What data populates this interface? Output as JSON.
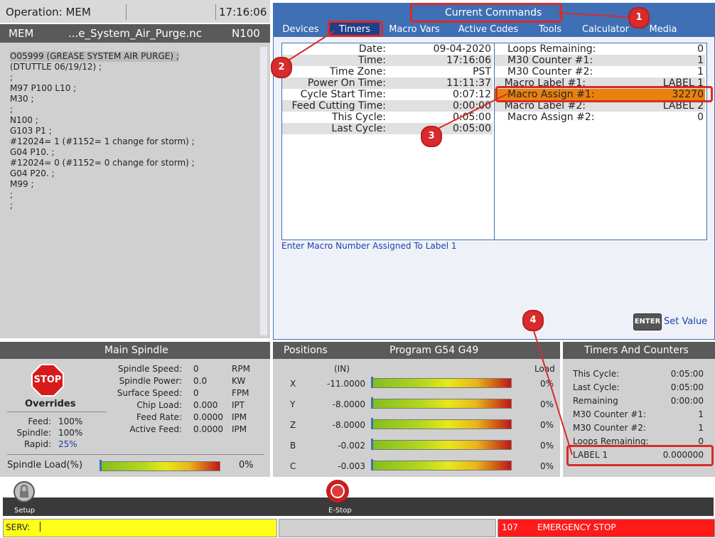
{
  "top_left": {
    "operation": "Operation: MEM",
    "time": "17:16:06"
  },
  "program_panel": {
    "mode": "MEM",
    "file": "...e_System_Air_Purge.nc",
    "line": "N100",
    "code_lines": [
      "O05999 (GREASE SYSTEM AIR PURGE) ;",
      "(DTUTTLE 06/19/12) ;",
      ";",
      "M97 P100 L10 ;",
      "M30 ;",
      ";",
      "N100 ;",
      "G103 P1 ;",
      "#12024= 1 (#1152= 1 change for storm) ;",
      "G04 P10. ;",
      "#12024= 0 (#1152= 0 change for storm) ;",
      "G04 P20. ;",
      "M99 ;",
      ";",
      ";"
    ]
  },
  "current_commands": {
    "title": "Current Commands",
    "tabs": [
      "Devices",
      "Timers",
      "Macro Vars",
      "Active Codes",
      "Tools",
      "Calculator",
      "Media"
    ],
    "left_rows": [
      {
        "label": "Date:",
        "value": "09-04-2020"
      },
      {
        "label": "Time:",
        "value": "17:16:06"
      },
      {
        "label": "Time Zone:",
        "value": "PST"
      },
      {
        "label": "Power On Time:",
        "value": "11:11:37"
      },
      {
        "label": "Cycle Start Time:",
        "value": "0:07:12"
      },
      {
        "label": "Feed Cutting Time:",
        "value": "0:00:00"
      },
      {
        "label": "This Cycle:",
        "value": "0:05:00"
      },
      {
        "label": "Last Cycle:",
        "value": "0:05:00"
      }
    ],
    "right_rows": [
      {
        "label": "Loops Remaining:",
        "value": "0"
      },
      {
        "label": "M30 Counter #1:",
        "value": "1"
      },
      {
        "label": "M30 Counter #2:",
        "value": "1"
      },
      {
        "label": "Macro Label #1:",
        "value": "LABEL 1"
      },
      {
        "label": "Macro Assign #1:",
        "value": "32270"
      },
      {
        "label": "Macro Label #2:",
        "value": "LABEL 2"
      },
      {
        "label": "Macro Assign #2:",
        "value": "0"
      }
    ],
    "hint": "Enter Macro Number Assigned To Label 1",
    "enter_key": "ENTER",
    "set_value": "Set Value"
  },
  "spindle": {
    "title": "Main Spindle",
    "stop": "STOP",
    "overrides_label": "Overrides",
    "overrides": [
      {
        "label": "Feed:",
        "value": "100%"
      },
      {
        "label": "Spindle:",
        "value": "100%"
      },
      {
        "label": "Rapid:",
        "value": "25%"
      }
    ],
    "stats": [
      {
        "label": "Spindle Speed:",
        "value": "0",
        "unit": "RPM"
      },
      {
        "label": "Spindle Power:",
        "value": "0.0",
        "unit": "KW"
      },
      {
        "label": "Surface Speed:",
        "value": "0",
        "unit": "FPM"
      },
      {
        "label": "Chip Load:",
        "value": "0.000",
        "unit": "IPT"
      },
      {
        "label": "Feed Rate:",
        "value": "0.0000",
        "unit": "IPM"
      },
      {
        "label": "Active Feed:",
        "value": "0.0000",
        "unit": "IPM"
      }
    ],
    "load_label": "Spindle Load(%)",
    "load_value": "0%",
    "load_fraction": 0
  },
  "positions": {
    "title": "Positions",
    "program": "Program G54 G49",
    "units": "(IN)",
    "load_label": "Load",
    "axes": [
      {
        "axis": "X",
        "value": "-11.0000",
        "load": "0%"
      },
      {
        "axis": "Y",
        "value": "-8.0000",
        "load": "0%"
      },
      {
        "axis": "Z",
        "value": "-8.0000",
        "load": "0%"
      },
      {
        "axis": "B",
        "value": "-0.002",
        "load": "0%"
      },
      {
        "axis": "C",
        "value": "-0.003",
        "load": "0%"
      }
    ]
  },
  "timers_counters": {
    "title": "Timers And Counters",
    "rows": [
      {
        "label": "This Cycle:",
        "value": "0:05:00"
      },
      {
        "label": "Last Cycle:",
        "value": "0:05:00"
      },
      {
        "label": "Remaining",
        "value": "0:00:00"
      },
      {
        "label": "M30 Counter #1:",
        "value": "1"
      },
      {
        "label": "M30 Counter #2:",
        "value": "1"
      },
      {
        "label": "Loops Remaining:",
        "value": "0"
      },
      {
        "label": "LABEL 1",
        "value": "0.000000"
      }
    ]
  },
  "bottom": {
    "setup": "Setup",
    "estop": "E-Stop",
    "serv": "SERV:",
    "alarm_code": "107",
    "alarm_text": "EMERGENCY STOP"
  },
  "callouts": [
    "1",
    "2",
    "3",
    "4"
  ],
  "colors": {
    "accent": "#3f6fb5",
    "highlight": "#e8820c",
    "alarm": "#ff1a1a",
    "serv": "#ffff1a",
    "callout": "#d92b2b"
  }
}
